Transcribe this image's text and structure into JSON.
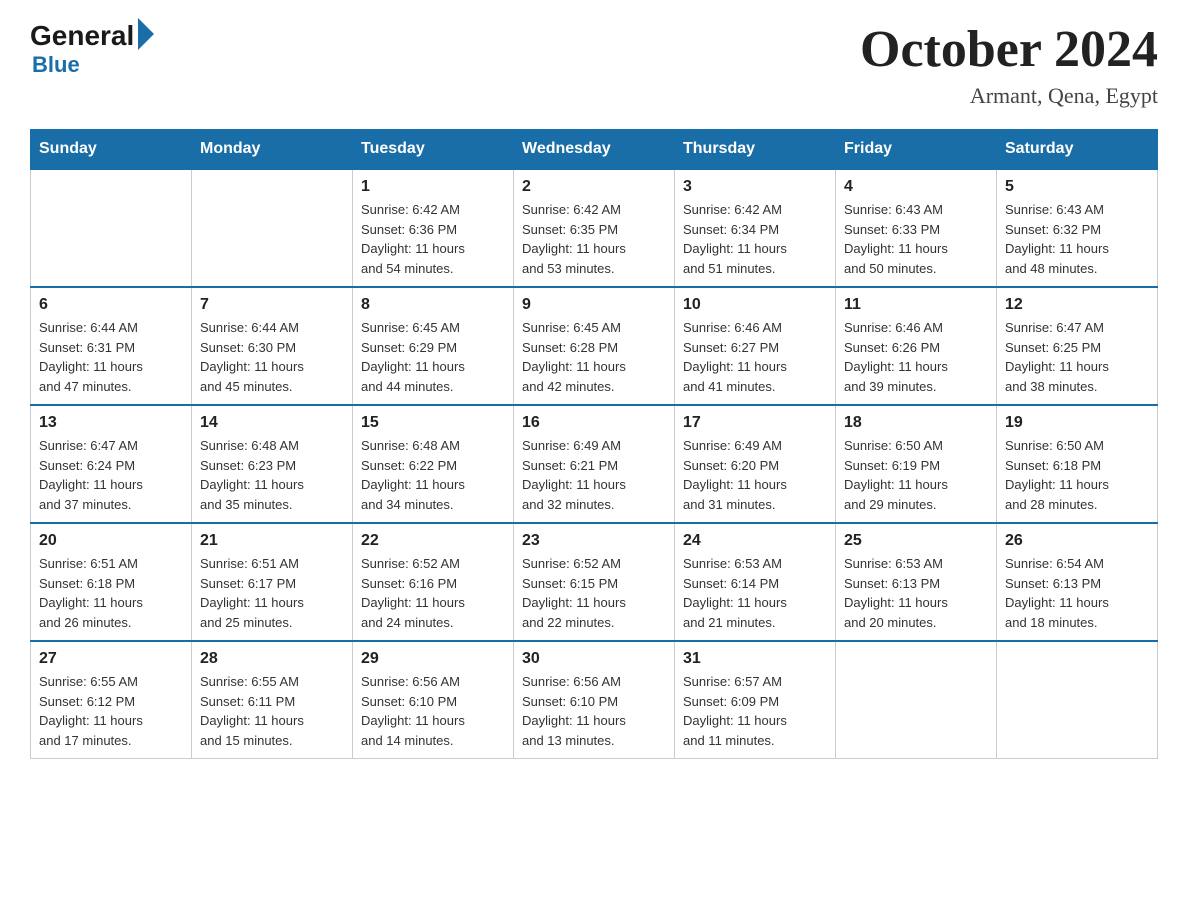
{
  "header": {
    "logo_general": "General",
    "logo_blue": "Blue",
    "month_title": "October 2024",
    "location": "Armant, Qena, Egypt"
  },
  "weekdays": [
    "Sunday",
    "Monday",
    "Tuesday",
    "Wednesday",
    "Thursday",
    "Friday",
    "Saturday"
  ],
  "weeks": [
    [
      {
        "day": "",
        "info": ""
      },
      {
        "day": "",
        "info": ""
      },
      {
        "day": "1",
        "info": "Sunrise: 6:42 AM\nSunset: 6:36 PM\nDaylight: 11 hours\nand 54 minutes."
      },
      {
        "day": "2",
        "info": "Sunrise: 6:42 AM\nSunset: 6:35 PM\nDaylight: 11 hours\nand 53 minutes."
      },
      {
        "day": "3",
        "info": "Sunrise: 6:42 AM\nSunset: 6:34 PM\nDaylight: 11 hours\nand 51 minutes."
      },
      {
        "day": "4",
        "info": "Sunrise: 6:43 AM\nSunset: 6:33 PM\nDaylight: 11 hours\nand 50 minutes."
      },
      {
        "day": "5",
        "info": "Sunrise: 6:43 AM\nSunset: 6:32 PM\nDaylight: 11 hours\nand 48 minutes."
      }
    ],
    [
      {
        "day": "6",
        "info": "Sunrise: 6:44 AM\nSunset: 6:31 PM\nDaylight: 11 hours\nand 47 minutes."
      },
      {
        "day": "7",
        "info": "Sunrise: 6:44 AM\nSunset: 6:30 PM\nDaylight: 11 hours\nand 45 minutes."
      },
      {
        "day": "8",
        "info": "Sunrise: 6:45 AM\nSunset: 6:29 PM\nDaylight: 11 hours\nand 44 minutes."
      },
      {
        "day": "9",
        "info": "Sunrise: 6:45 AM\nSunset: 6:28 PM\nDaylight: 11 hours\nand 42 minutes."
      },
      {
        "day": "10",
        "info": "Sunrise: 6:46 AM\nSunset: 6:27 PM\nDaylight: 11 hours\nand 41 minutes."
      },
      {
        "day": "11",
        "info": "Sunrise: 6:46 AM\nSunset: 6:26 PM\nDaylight: 11 hours\nand 39 minutes."
      },
      {
        "day": "12",
        "info": "Sunrise: 6:47 AM\nSunset: 6:25 PM\nDaylight: 11 hours\nand 38 minutes."
      }
    ],
    [
      {
        "day": "13",
        "info": "Sunrise: 6:47 AM\nSunset: 6:24 PM\nDaylight: 11 hours\nand 37 minutes."
      },
      {
        "day": "14",
        "info": "Sunrise: 6:48 AM\nSunset: 6:23 PM\nDaylight: 11 hours\nand 35 minutes."
      },
      {
        "day": "15",
        "info": "Sunrise: 6:48 AM\nSunset: 6:22 PM\nDaylight: 11 hours\nand 34 minutes."
      },
      {
        "day": "16",
        "info": "Sunrise: 6:49 AM\nSunset: 6:21 PM\nDaylight: 11 hours\nand 32 minutes."
      },
      {
        "day": "17",
        "info": "Sunrise: 6:49 AM\nSunset: 6:20 PM\nDaylight: 11 hours\nand 31 minutes."
      },
      {
        "day": "18",
        "info": "Sunrise: 6:50 AM\nSunset: 6:19 PM\nDaylight: 11 hours\nand 29 minutes."
      },
      {
        "day": "19",
        "info": "Sunrise: 6:50 AM\nSunset: 6:18 PM\nDaylight: 11 hours\nand 28 minutes."
      }
    ],
    [
      {
        "day": "20",
        "info": "Sunrise: 6:51 AM\nSunset: 6:18 PM\nDaylight: 11 hours\nand 26 minutes."
      },
      {
        "day": "21",
        "info": "Sunrise: 6:51 AM\nSunset: 6:17 PM\nDaylight: 11 hours\nand 25 minutes."
      },
      {
        "day": "22",
        "info": "Sunrise: 6:52 AM\nSunset: 6:16 PM\nDaylight: 11 hours\nand 24 minutes."
      },
      {
        "day": "23",
        "info": "Sunrise: 6:52 AM\nSunset: 6:15 PM\nDaylight: 11 hours\nand 22 minutes."
      },
      {
        "day": "24",
        "info": "Sunrise: 6:53 AM\nSunset: 6:14 PM\nDaylight: 11 hours\nand 21 minutes."
      },
      {
        "day": "25",
        "info": "Sunrise: 6:53 AM\nSunset: 6:13 PM\nDaylight: 11 hours\nand 20 minutes."
      },
      {
        "day": "26",
        "info": "Sunrise: 6:54 AM\nSunset: 6:13 PM\nDaylight: 11 hours\nand 18 minutes."
      }
    ],
    [
      {
        "day": "27",
        "info": "Sunrise: 6:55 AM\nSunset: 6:12 PM\nDaylight: 11 hours\nand 17 minutes."
      },
      {
        "day": "28",
        "info": "Sunrise: 6:55 AM\nSunset: 6:11 PM\nDaylight: 11 hours\nand 15 minutes."
      },
      {
        "day": "29",
        "info": "Sunrise: 6:56 AM\nSunset: 6:10 PM\nDaylight: 11 hours\nand 14 minutes."
      },
      {
        "day": "30",
        "info": "Sunrise: 6:56 AM\nSunset: 6:10 PM\nDaylight: 11 hours\nand 13 minutes."
      },
      {
        "day": "31",
        "info": "Sunrise: 6:57 AM\nSunset: 6:09 PM\nDaylight: 11 hours\nand 11 minutes."
      },
      {
        "day": "",
        "info": ""
      },
      {
        "day": "",
        "info": ""
      }
    ]
  ]
}
